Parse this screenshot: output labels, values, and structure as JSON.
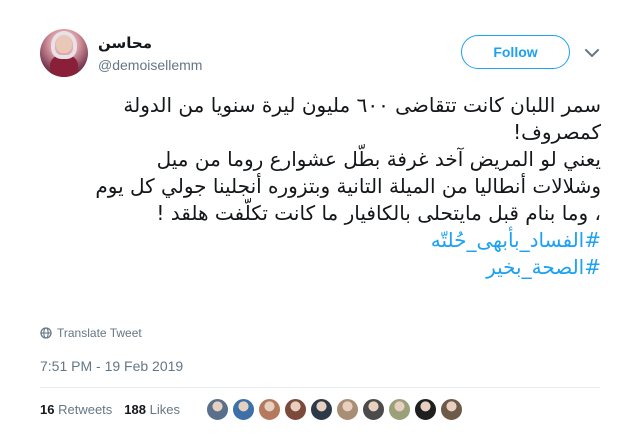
{
  "author": {
    "name": "محاسن",
    "handle": "@demoisellemm"
  },
  "follow_button": {
    "label": "Follow"
  },
  "tweet": {
    "lines": [
      "سمر اللبان كانت تتقاضى ٦٠٠ مليون ليرة سنويا من الدولة",
      "كمصروف!",
      "يعني لو المريض آخد غرفة بطّل عشوارع روما من ميل",
      "وشلالات أنطاليا من الميلة التانية وبتزوره أنجلينا جولي كل يوم",
      "، وما بنام قبل مايتحلى بالكافيار ما كانت تكلّفت هلقد !"
    ],
    "hashtags": [
      "#الفساد_بأبهى_حُلتّه",
      "#الصحة_بخير"
    ]
  },
  "translate": {
    "label": "Translate Tweet"
  },
  "timestamp": "7:51 PM - 19 Feb 2019",
  "stats": {
    "retweets_count": "16",
    "retweets_label": "Retweets",
    "likes_count": "188",
    "likes_label": "Likes"
  },
  "likers": [
    {
      "icon": "user-avatar",
      "color": "#5a6f8a"
    },
    {
      "icon": "user-avatar",
      "color": "#3d6fa8"
    },
    {
      "icon": "user-avatar",
      "color": "#b47a5e"
    },
    {
      "icon": "user-avatar",
      "color": "#7c4a3a"
    },
    {
      "icon": "user-avatar",
      "color": "#2e3a47"
    },
    {
      "icon": "user-avatar",
      "color": "#a88e74"
    },
    {
      "icon": "user-avatar",
      "color": "#4b4b4b"
    },
    {
      "icon": "user-avatar",
      "color": "#9aa07a"
    },
    {
      "icon": "user-avatar",
      "color": "#1f1f1f"
    },
    {
      "icon": "user-avatar",
      "color": "#6e5a48"
    }
  ],
  "colors": {
    "accent": "#1da1f2",
    "muted": "#657786",
    "text": "#14171a",
    "divider": "#e6ecf0"
  }
}
